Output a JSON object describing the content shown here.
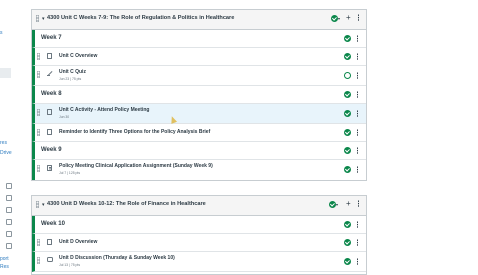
{
  "sidebar": {
    "fragments": [
      "s",
      "res",
      "Drive",
      "port",
      "Res"
    ]
  },
  "modules": [
    {
      "title": "4300 Unit C Weeks 7-9: The Role of Regulation & Politics in Healthcare",
      "rows": [
        {
          "kind": "header",
          "title": "Week 7"
        },
        {
          "kind": "page",
          "title": "Unit C Overview",
          "meta": "",
          "status": "published"
        },
        {
          "kind": "quiz",
          "title": "Unit C Quiz",
          "meta": "Jun 23  |  75 pts",
          "status": "unpublished"
        },
        {
          "kind": "header",
          "title": "Week 8"
        },
        {
          "kind": "page",
          "title": "Unit C Activity - Attend Policy Meeting",
          "meta": "Jun 30",
          "status": "published",
          "highlight": true
        },
        {
          "kind": "page",
          "title": "Reminder to Identify Three Options for the Policy Analysis Brief",
          "meta": "",
          "status": "published"
        },
        {
          "kind": "header",
          "title": "Week 9"
        },
        {
          "kind": "assignment",
          "title": "Policy Meeting Clinical Application Assignment (Sunday Week 9)",
          "meta": "Jul 7  |  125 pts",
          "status": "published"
        }
      ]
    },
    {
      "title": "4300 Unit D Weeks 10-12: The Role of Finance in Healthcare",
      "rows": [
        {
          "kind": "header",
          "title": "Week 10"
        },
        {
          "kind": "page",
          "title": "Unit D Overview",
          "meta": "",
          "status": "published"
        },
        {
          "kind": "discussion",
          "title": "Unit D Discussion (Thursday & Sunday Week 10)",
          "meta": "Jul 13  |  75 pts",
          "status": "published"
        }
      ]
    }
  ],
  "icons": {
    "published": "check-circle-icon",
    "unpublished": "cog-circle-icon",
    "options": "kebab-icon",
    "drag": "drag-handle-icon",
    "add": "plus-icon"
  },
  "colors": {
    "published_green": "#0b874b",
    "header_bg": "#f5f5f5",
    "highlight_bg": "#e8f4fb",
    "text": "#2d3b45"
  },
  "labels": {
    "add": "+"
  }
}
